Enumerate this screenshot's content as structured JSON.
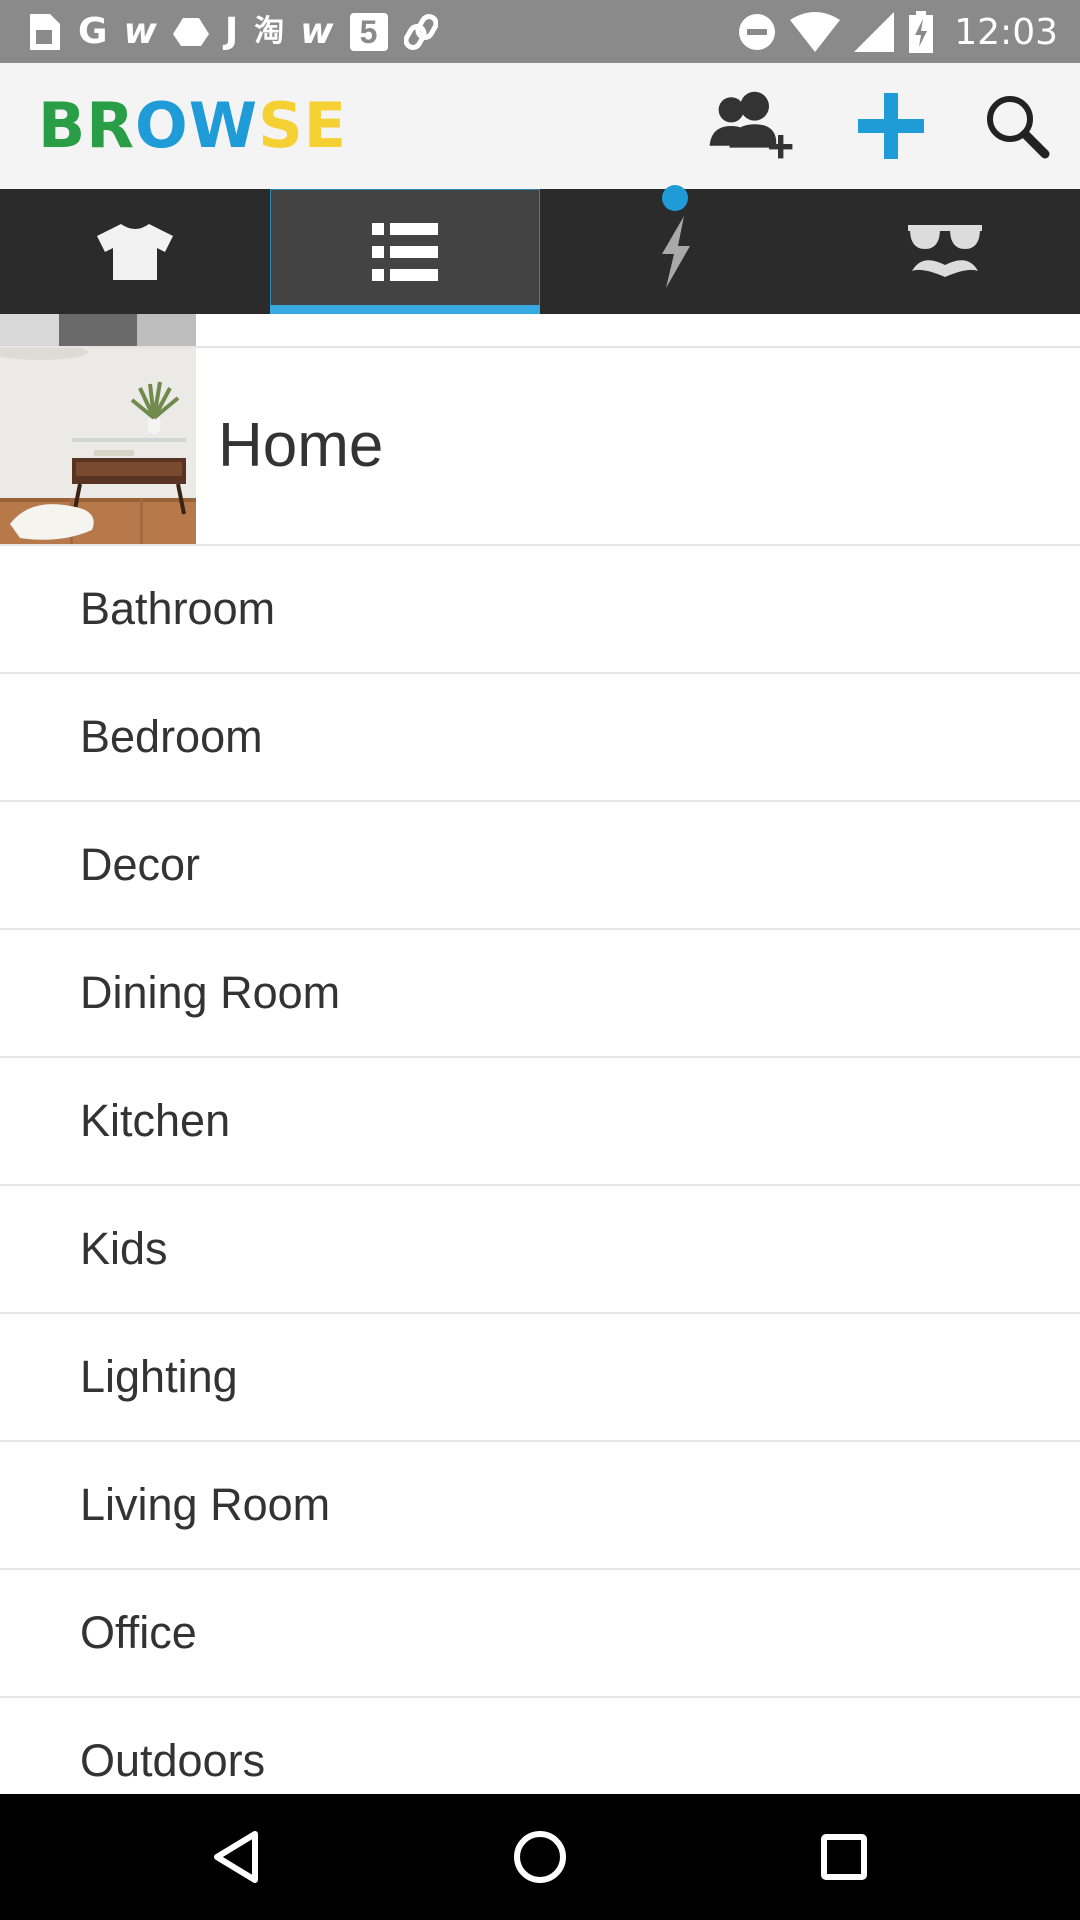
{
  "status_bar": {
    "time": "12:03",
    "notification_icons": [
      "G",
      "w",
      "J",
      "淘",
      "w",
      "5"
    ],
    "icons": [
      "sim-card-icon",
      "gmail-g-icon",
      "wish-icon",
      "drive-icon",
      "j-app-icon",
      "taobao-icon",
      "wish-icon",
      "html5-icon",
      "link-icon",
      "do-not-disturb-icon",
      "wifi-icon",
      "signal-icon",
      "battery-charging-icon"
    ]
  },
  "app_bar": {
    "brand": {
      "part1": "BR",
      "part2": "OW",
      "part3": "SE"
    },
    "brand_colors": [
      "#2a9d47",
      "#1f9bd7",
      "#f5d033"
    ],
    "actions": [
      "add-friend-icon",
      "plus-icon",
      "search-icon"
    ]
  },
  "tabs": [
    {
      "icon": "tshirt-icon",
      "active": false
    },
    {
      "icon": "list-icon",
      "active": true
    },
    {
      "icon": "lightning-icon",
      "active": false,
      "has_notification": true
    },
    {
      "icon": "sunglasses-mustache-icon",
      "active": false
    }
  ],
  "accent_color": "#36a9e1",
  "category": {
    "title": "Home",
    "subcategories": [
      "Bathroom",
      "Bedroom",
      "Decor",
      "Dining Room",
      "Kitchen",
      "Kids",
      "Lighting",
      "Living Room",
      "Office",
      "Outdoors"
    ]
  },
  "nav_bar": {
    "buttons": [
      "back-icon",
      "home-icon",
      "recents-icon"
    ]
  }
}
